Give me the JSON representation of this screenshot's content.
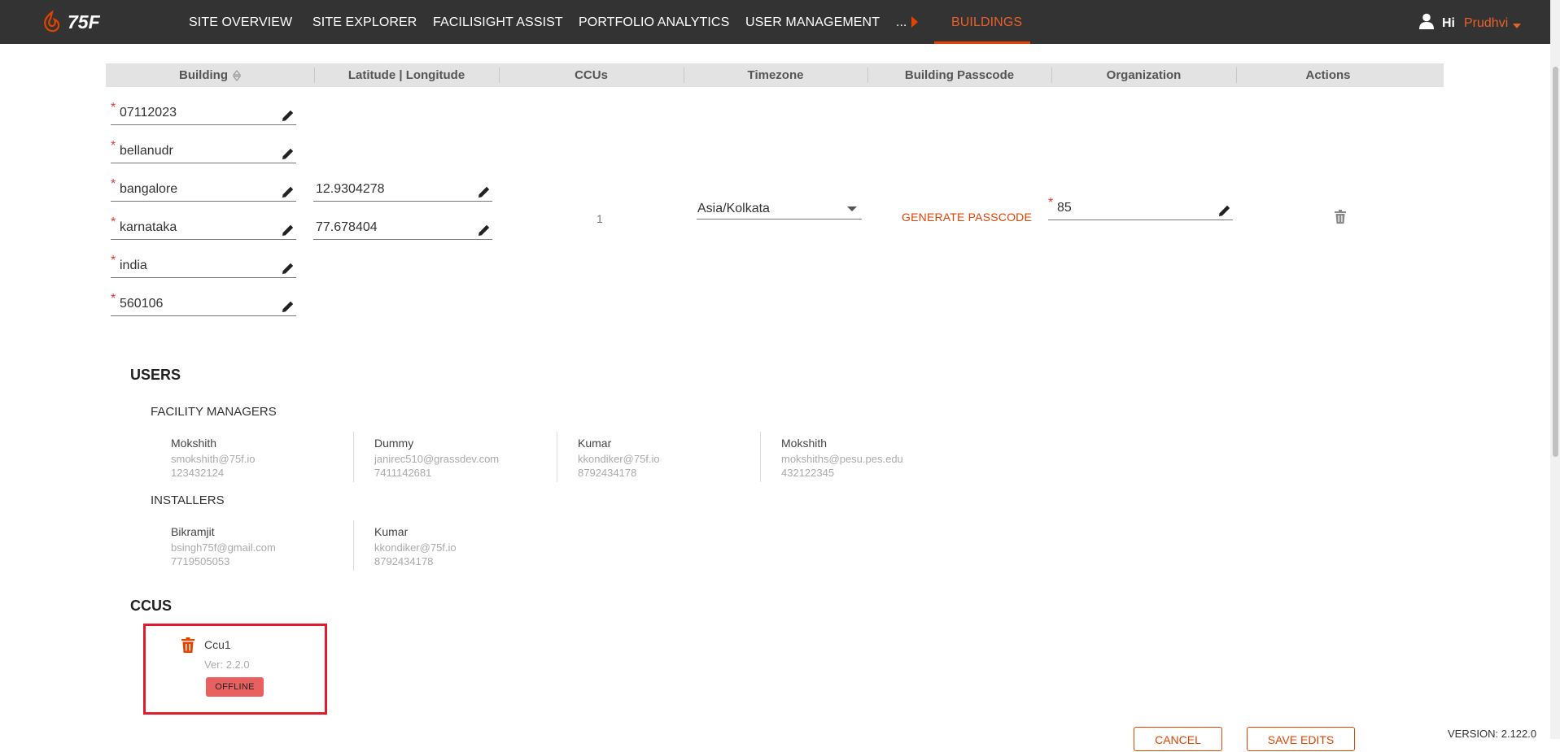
{
  "nav": {
    "logo_text": "75F",
    "items": [
      "SITE OVERVIEW",
      "SITE EXPLORER",
      "FACILISIGHT ASSIST",
      "PORTFOLIO ANALYTICS",
      "USER MANAGEMENT"
    ],
    "more": "...",
    "active": "BUILDINGS",
    "greeting": "Hi",
    "user": "Prudhvi"
  },
  "table": {
    "headers": [
      "Building",
      "Latitude | Longitude",
      "CCUs",
      "Timezone",
      "Building Passcode",
      "Organization",
      "Actions"
    ]
  },
  "building": {
    "fields": [
      "07112023",
      "bellanudr",
      "bangalore",
      "karnataka",
      "india",
      "560106"
    ],
    "latitude": "12.9304278",
    "longitude": "77.678404",
    "ccus": "1",
    "timezone": "Asia/Kolkata",
    "passcode_action": "GENERATE PASSCODE",
    "organization": "85"
  },
  "users": {
    "title": "USERS",
    "facility_managers": {
      "title": "FACILITY MANAGERS",
      "list": [
        {
          "name": "Mokshith",
          "email": "smokshith@75f.io",
          "phone": "123432124"
        },
        {
          "name": "Dummy",
          "email": "janirec510@grassdev.com",
          "phone": "7411142681"
        },
        {
          "name": "Kumar",
          "email": "kkondiker@75f.io",
          "phone": "8792434178"
        },
        {
          "name": "Mokshith",
          "email": "mokshiths@pesu.pes.edu",
          "phone": "432122345"
        }
      ]
    },
    "installers": {
      "title": "INSTALLERS",
      "list": [
        {
          "name": "Bikramjit",
          "email": "bsingh75f@gmail.com",
          "phone": "7719505053"
        },
        {
          "name": "Kumar",
          "email": "kkondiker@75f.io",
          "phone": "8792434178"
        }
      ]
    }
  },
  "ccus": {
    "title": "CCUS",
    "list": [
      {
        "name": "Ccu1",
        "version": "Ver: 2.2.0",
        "status": "OFFLINE"
      }
    ]
  },
  "footer": {
    "cancel": "CANCEL",
    "save": "SAVE EDITS",
    "version": "VERSION: 2.122.0"
  },
  "colors": {
    "accent": "#e24301",
    "topbar": "#333333",
    "offline_badge": "#e86060",
    "highlight_box": "#e01b2c"
  }
}
